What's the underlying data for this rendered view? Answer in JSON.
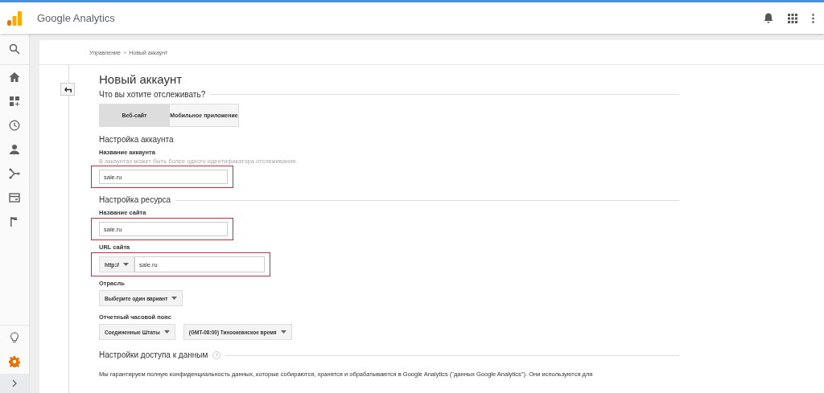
{
  "app": {
    "title": "Google Analytics"
  },
  "sidebar": {
    "items": [
      {
        "kind": "search",
        "selected": false
      },
      {
        "kind": "home",
        "selected": false
      },
      {
        "kind": "dashboard",
        "selected": false
      },
      {
        "kind": "clock",
        "selected": false
      },
      {
        "kind": "person",
        "selected": false
      },
      {
        "kind": "fork",
        "selected": false
      },
      {
        "kind": "card",
        "selected": false
      },
      {
        "kind": "flag",
        "selected": false
      }
    ],
    "bottom_items": [
      {
        "kind": "bulb",
        "selected": false
      },
      {
        "kind": "gear",
        "selected": true
      },
      {
        "kind": "chevron",
        "selected": false
      }
    ]
  },
  "breadcrumb": [
    "Управление",
    "›",
    "Новый аккаунт"
  ],
  "page_title": "Новый аккаунт",
  "question": "Что вы хотите отслеживать?",
  "tabs": [
    {
      "label": "Веб-сайт",
      "selected": true
    },
    {
      "label": "Мобильное приложение",
      "selected": false
    }
  ],
  "account_section": {
    "heading": "Настройка аккаунта",
    "label": "Название аккаунта",
    "hint": "В аккаунтах может быть более одного идентификатора отслеживания.",
    "value": "sale.ru",
    "highlighted": true
  },
  "resource_section": {
    "heading": "Настройка ресурса",
    "site_name": {
      "label": "Название сайта",
      "value": "sale.ru",
      "highlighted": true
    },
    "site_url": {
      "label": "URL сайта",
      "protocol": "http://",
      "value": "sale.ru",
      "highlighted": true
    },
    "industry": {
      "label": "Отрасль",
      "value": "Выберите один вариант"
    },
    "timezone": {
      "label": "Отчетный часовой пояс",
      "country": "Соединенные Штаты",
      "zone": "(GMT-08:00) Тихоокеанское время"
    }
  },
  "data_sharing": {
    "heading": "Настройки доступа к данным",
    "help": "?",
    "text": "Мы гарантируем полную конфиденциальность данных, которые собираются, хранятся и обрабатываются в Google Analytics (\"данных Google Analytics\"). Они используются для"
  }
}
